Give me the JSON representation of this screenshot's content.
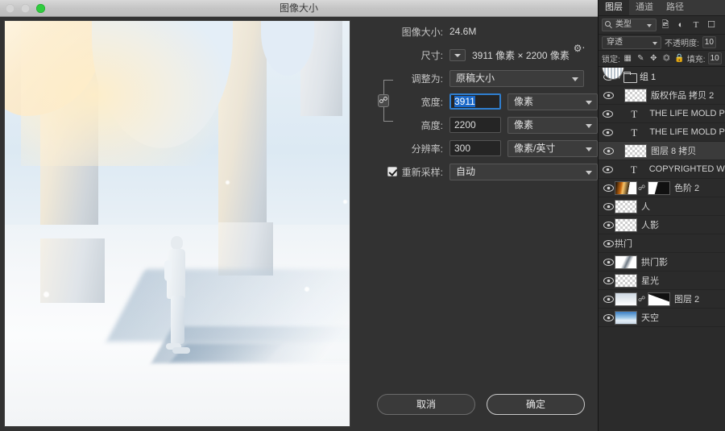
{
  "window": {
    "title": "图像大小",
    "traffic_lights": [
      "close-disabled",
      "minimize-disabled",
      "zoom-green"
    ]
  },
  "dialog": {
    "image_size_label": "图像大小:",
    "image_size_value": "24.6M",
    "gear_icon": "gear-icon",
    "dimensions_label": "尺寸:",
    "dimensions_value": "3911 像素  ×  2200 像素",
    "fit_to_label": "调整为:",
    "fit_to_value": "原稿大小",
    "width_label": "宽度:",
    "width_value": "3911",
    "width_unit": "像素",
    "height_label": "高度:",
    "height_value": "2200",
    "height_unit": "像素",
    "resolution_label": "分辨率:",
    "resolution_value": "300",
    "resolution_unit": "像素/英寸",
    "resample_label": "重新采样:",
    "resample_value": "自动",
    "resample_checked": true,
    "link_icon": "chain-link-icon",
    "cancel_label": "取消",
    "ok_label": "确定"
  },
  "panel": {
    "tabs": [
      {
        "label": "图层",
        "active": true
      },
      {
        "label": "通道",
        "active": false
      },
      {
        "label": "路径",
        "active": false
      }
    ],
    "filter": {
      "search_icon": "search-icon",
      "type_label": "类型",
      "icons": [
        "image-filter-icon",
        "adjustment-filter-icon",
        "text-filter-icon",
        "shape-filter-icon"
      ]
    },
    "blend_mode": "穿透",
    "opacity_label": "不透明度:",
    "opacity_value": "10",
    "lock_label": "锁定:",
    "lock_icons": [
      "transparent-pixels-icon",
      "image-pixels-icon",
      "position-icon",
      "artboard-nesting-icon",
      "lock-all-icon"
    ],
    "fill_label": "填充:",
    "fill_value": "10",
    "layers": [
      {
        "name": "组 1",
        "kind": "group",
        "visible": true,
        "selected": false,
        "indent": 0
      },
      {
        "name": "版权作品 拷贝 2",
        "kind": "pixel",
        "thumb": "transparent",
        "visible": true,
        "selected": false,
        "indent": 1
      },
      {
        "name": "THE LIFE MOLD PL",
        "kind": "text",
        "visible": true,
        "selected": false,
        "indent": 1
      },
      {
        "name": "THE LIFE MOLD PL",
        "kind": "text",
        "visible": true,
        "selected": false,
        "indent": 1
      },
      {
        "name": "图层 8 拷贝",
        "kind": "pixel",
        "thumb": "transparent",
        "visible": true,
        "selected": true,
        "indent": 1
      },
      {
        "name": "COPYRIGHTED WO",
        "kind": "text",
        "visible": true,
        "selected": false,
        "indent": 1
      },
      {
        "name": "色阶 2",
        "kind": "adjustment",
        "thumb": "levels",
        "mask": "maskA",
        "linked": true,
        "visible": true,
        "selected": false,
        "indent": 0
      },
      {
        "name": "人",
        "kind": "pixel",
        "thumb": "transparent",
        "visible": true,
        "selected": false,
        "indent": 0
      },
      {
        "name": "人影",
        "kind": "pixel",
        "thumb": "transparent",
        "visible": true,
        "selected": false,
        "indent": 0
      },
      {
        "name": "拱门",
        "kind": "pixel",
        "thumb": "arch",
        "visible": true,
        "selected": false,
        "indent": 0
      },
      {
        "name": "拱门影",
        "kind": "pixel",
        "thumb": "archs",
        "visible": true,
        "selected": false,
        "indent": 0
      },
      {
        "name": "星光",
        "kind": "pixel",
        "thumb": "transparent",
        "visible": true,
        "selected": false,
        "indent": 0
      },
      {
        "name": "图层 2",
        "kind": "pixel",
        "thumb": "grad",
        "mask": "maskB",
        "linked": true,
        "visible": true,
        "selected": false,
        "indent": 0
      },
      {
        "name": "天空",
        "kind": "pixel",
        "thumb": "sky",
        "visible": true,
        "selected": false,
        "indent": 0
      }
    ]
  },
  "colors": {
    "dialog_bg": "#323232",
    "panel_bg": "#2b2b2b",
    "accent_blue": "#1a68c8",
    "focus_blue": "#2f7fd0"
  }
}
